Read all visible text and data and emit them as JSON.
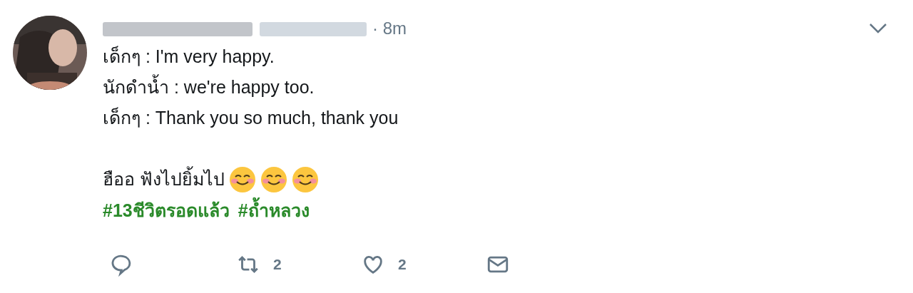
{
  "tweet": {
    "avatar": {
      "kind": "picture"
    },
    "time": "· 8m",
    "lines": [
      "เด็กๆ : I'm very happy.",
      "นักดำน้ำ : we're happy too.",
      "เด็กๆ : Thank you so much, thank you"
    ],
    "closing": "ฮืออ ฟังไปยิ้มไป",
    "hashtags": [
      "#13ชีวิตรอดแล้ว",
      "#ถ้ำหลวง"
    ],
    "actions": [
      {
        "kind": "reply"
      },
      {
        "kind": "retweet",
        "count": "2"
      },
      {
        "kind": "like",
        "count": "2"
      },
      {
        "kind": "message"
      }
    ]
  }
}
